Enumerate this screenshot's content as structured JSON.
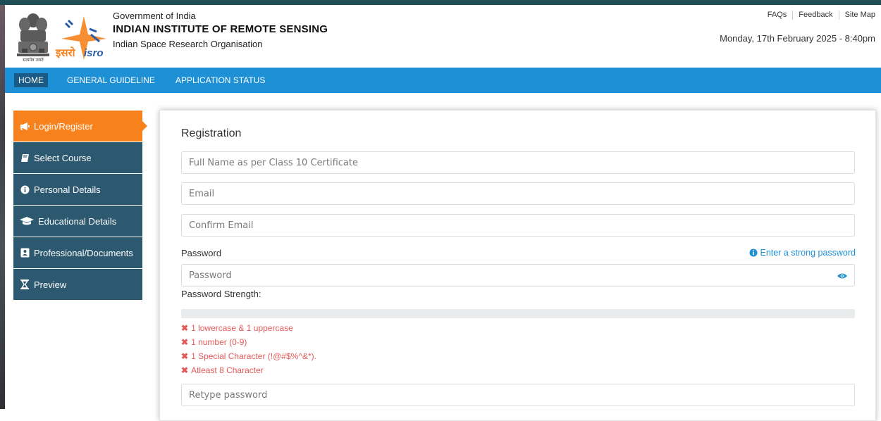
{
  "header": {
    "gov_label": "Government of India",
    "institute": "INDIAN INSTITUTE OF REMOTE SENSING",
    "org": "Indian Space Research Organisation",
    "emblem_motto": "सत्यमेव जयते",
    "isro_hindi": "इसरो",
    "isro_en": "isro",
    "links": [
      "FAQs",
      "Feedback",
      "Site Map"
    ],
    "datetime": "Monday, 17th February 2025 - 8:40pm"
  },
  "nav": {
    "home": "HOME",
    "guideline": "GENERAL GUIDELINE",
    "status": "APPLICATION STATUS"
  },
  "sidebar": {
    "items": [
      {
        "label": "Login/Register",
        "icon": "bullhorn-icon",
        "active": true
      },
      {
        "label": "Select Course",
        "icon": "book-icon"
      },
      {
        "label": "Personal Details",
        "icon": "info-circle-icon"
      },
      {
        "label": "Educational Details",
        "icon": "graduation-cap-icon"
      },
      {
        "label": "Professional/Documents",
        "icon": "id-card-icon"
      },
      {
        "label": "Preview",
        "icon": "hourglass-icon"
      }
    ]
  },
  "form": {
    "title": "Registration",
    "full_name_placeholder": "Full Name as per Class 10 Certificate",
    "email_placeholder": "Email",
    "confirm_email_placeholder": "Confirm Email",
    "password_label": "Password",
    "password_hint": "Enter a strong password",
    "password_placeholder": "Password",
    "strength_label": "Password Strength:",
    "strength_value": 0,
    "rules": [
      "1 lowercase & 1 uppercase",
      "1 number (0-9)",
      "1 Special Character (!@#$%^&*).",
      "Atleast 8 Character"
    ],
    "retype_placeholder": "Retype password"
  },
  "colors": {
    "nav_blue": "#1e90d6",
    "sidebar_dark": "#2d5970",
    "sidebar_active": "#f7821d",
    "rule_red": "#e25a5a"
  }
}
